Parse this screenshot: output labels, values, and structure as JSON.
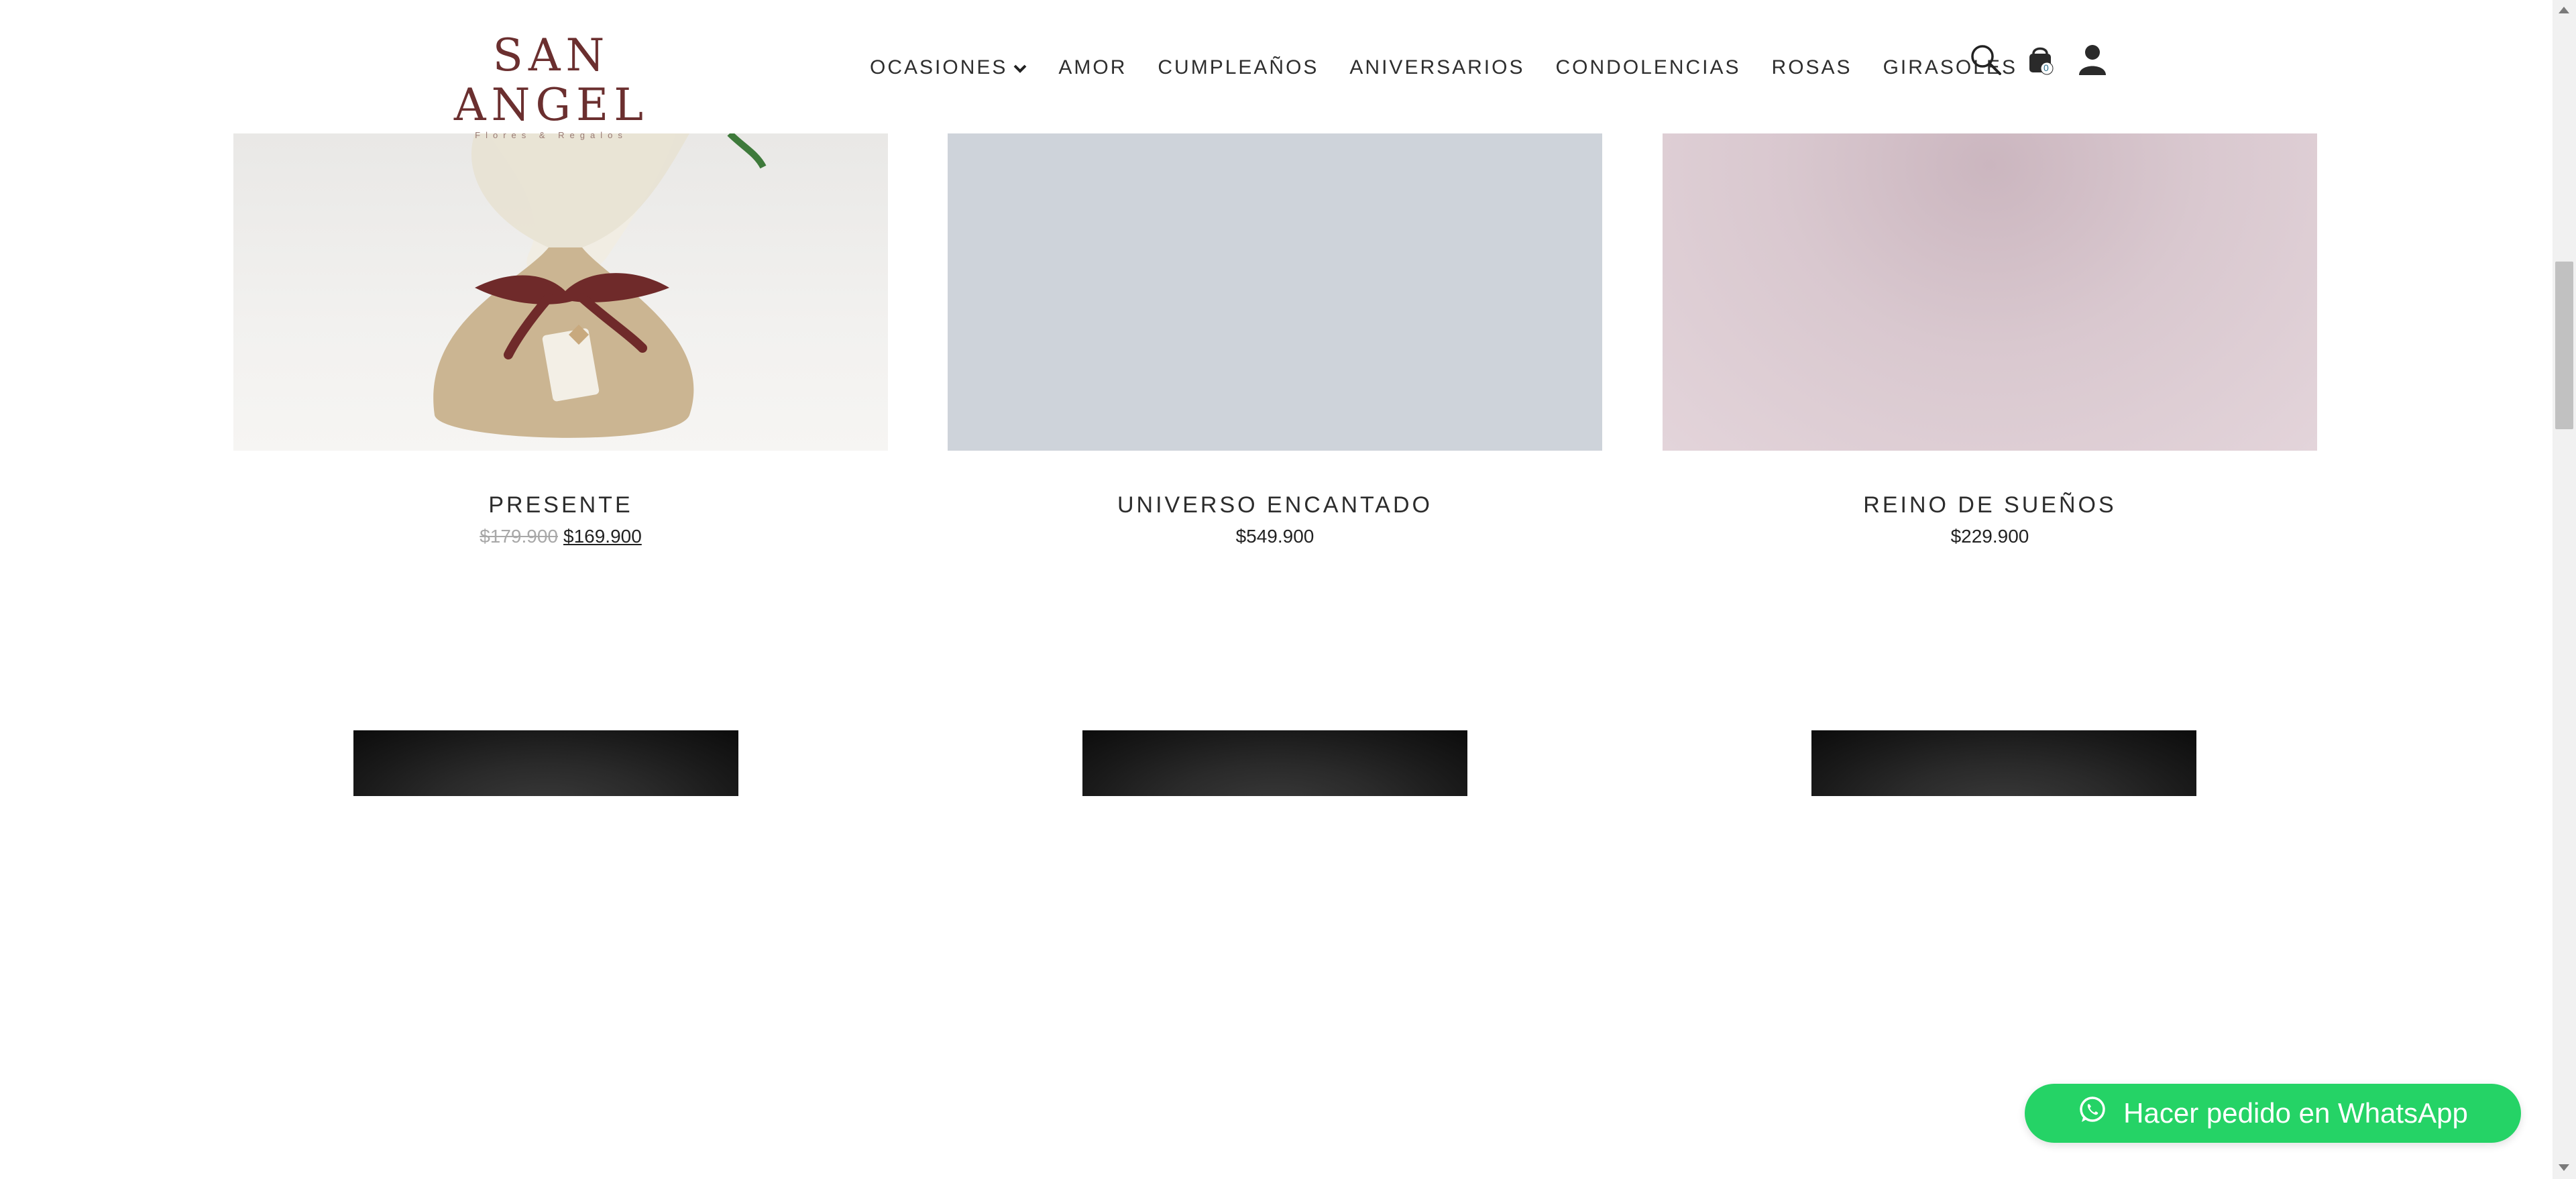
{
  "brand": {
    "name": "SAN ANGEL",
    "tagline": "Flores & Regalos"
  },
  "nav": {
    "items": [
      {
        "label": "OCASIONES",
        "has_dropdown": true
      },
      {
        "label": "AMOR"
      },
      {
        "label": "CUMPLEAÑOS"
      },
      {
        "label": "ANIVERSARIOS"
      },
      {
        "label": "CONDOLENCIAS"
      },
      {
        "label": "ROSAS"
      },
      {
        "label": "GIRASOLES"
      }
    ],
    "icons": [
      "search-icon",
      "cart-icon",
      "account-icon"
    ],
    "cart_count": "0"
  },
  "products": [
    {
      "name": "PRESENTE",
      "old_price": "$179.900",
      "price": "$169.900"
    },
    {
      "name": "UNIVERSO ENCANTADO",
      "price": "$549.900"
    },
    {
      "name": "REINO DE SUEÑOS",
      "price": "$229.900"
    }
  ],
  "whatsapp": {
    "label": "Hacer pedido en WhatsApp",
    "color": "#25d366"
  },
  "colors": {
    "brand": "#6b2f2f",
    "accent_green": "#25d366",
    "text": "#2b2b2b"
  }
}
